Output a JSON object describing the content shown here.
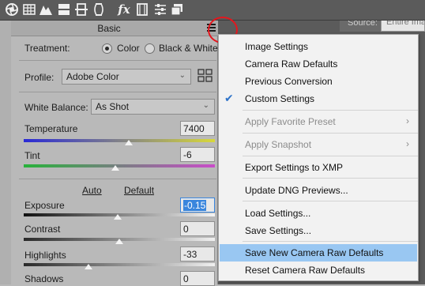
{
  "source": {
    "label": "Source:",
    "value": "Entire Image"
  },
  "toolbar": {
    "icons": [
      "aperture-icon",
      "grid-icon",
      "mountains-icon",
      "split-toning-icon",
      "columns-icon",
      "fx-icon",
      "film-icon",
      "sliders-icon",
      "stack-icon"
    ],
    "fx_label": "fx"
  },
  "panel": {
    "title": "Basic",
    "treatment": {
      "label": "Treatment:",
      "options": [
        "Color",
        "Black & White"
      ],
      "selected": "Color"
    },
    "profile": {
      "label": "Profile:",
      "value": "Adobe Color"
    },
    "white_balance": {
      "label": "White Balance:",
      "value": "As Shot"
    },
    "temperature": {
      "label": "Temperature",
      "value": "7400",
      "level": 0.55
    },
    "tint": {
      "label": "Tint",
      "value": "-6",
      "level": 0.48
    },
    "auto_label": "Auto",
    "default_label": "Default",
    "exposure": {
      "label": "Exposure",
      "value": "-0.15",
      "level": 0.49
    },
    "contrast": {
      "label": "Contrast",
      "value": "0",
      "level": 0.5
    },
    "highlights": {
      "label": "Highlights",
      "value": "-33",
      "level": 0.34
    },
    "shadows": {
      "label": "Shadows",
      "value": "0"
    }
  },
  "menu": {
    "items": [
      {
        "label": "Image Settings"
      },
      {
        "label": "Camera Raw Defaults"
      },
      {
        "label": "Previous Conversion"
      },
      {
        "label": "Custom Settings",
        "checked": true
      },
      {
        "label": "Apply Favorite Preset",
        "disabled": true,
        "submenu": true
      },
      {
        "label": "Apply Snapshot",
        "disabled": true,
        "submenu": true
      },
      {
        "label": "Export Settings to XMP"
      },
      {
        "label": "Update DNG Previews..."
      },
      {
        "label": "Load Settings..."
      },
      {
        "label": "Save Settings..."
      },
      {
        "label": "Save New Camera Raw Defaults",
        "highlighted": true
      },
      {
        "label": "Reset Camera Raw Defaults"
      }
    ],
    "check_glyph": "✔",
    "submenu_glyph": "›"
  },
  "colors": {
    "highlight_ring": "#e5161d",
    "menu_hover": "#99c7f2",
    "selection_blue": "#3a86dd"
  }
}
